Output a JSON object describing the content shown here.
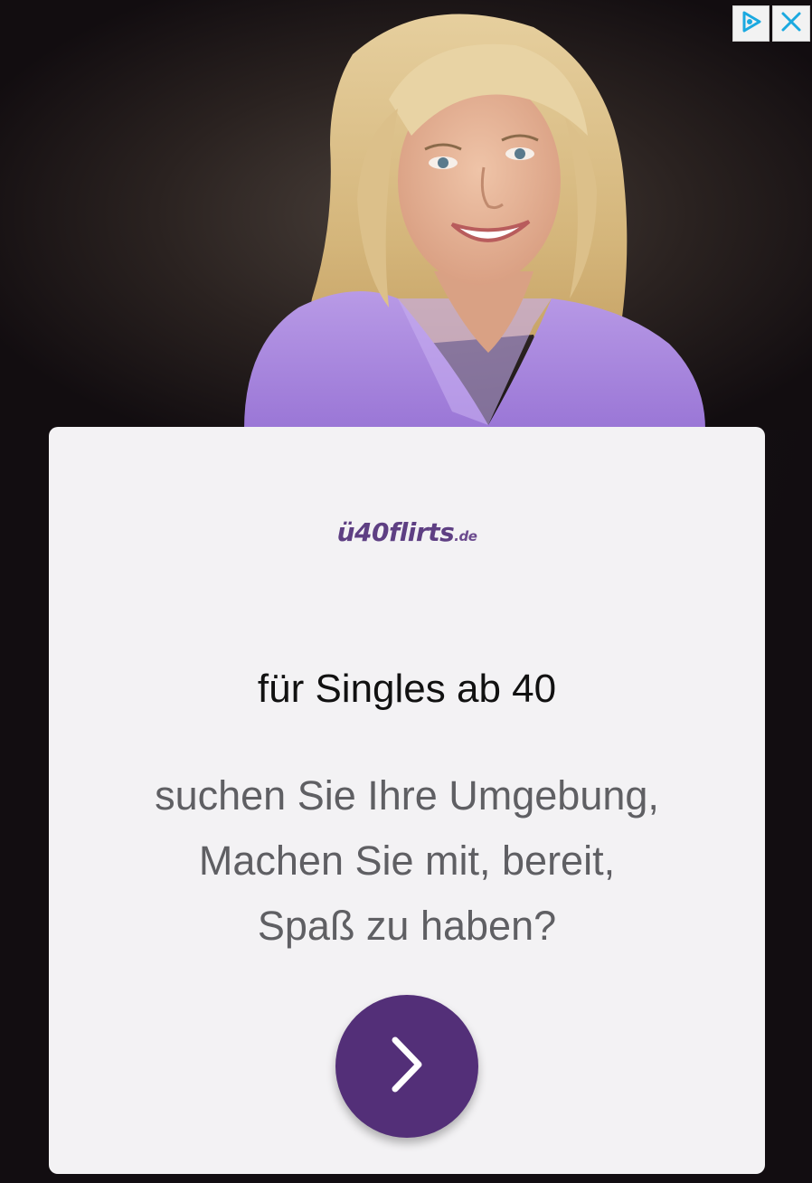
{
  "ad": {
    "brand": {
      "name": "ü40flirts",
      "tld": ".de"
    },
    "headline": "für Singles ab 40",
    "body_lines": [
      "suchen Sie Ihre Umgebung,",
      "Machen Sie mit, bereit,",
      "Spaß zu haben?"
    ],
    "cta_icon": "chevron-right-icon",
    "controls": {
      "adchoices_icon": "adchoices-icon",
      "close_icon": "close-icon"
    },
    "colors": {
      "accent": "#532f78",
      "brand": "#6b4a8e",
      "card_background": "#f3f2f4",
      "ad_control_icon": "#1aa9e0"
    }
  }
}
